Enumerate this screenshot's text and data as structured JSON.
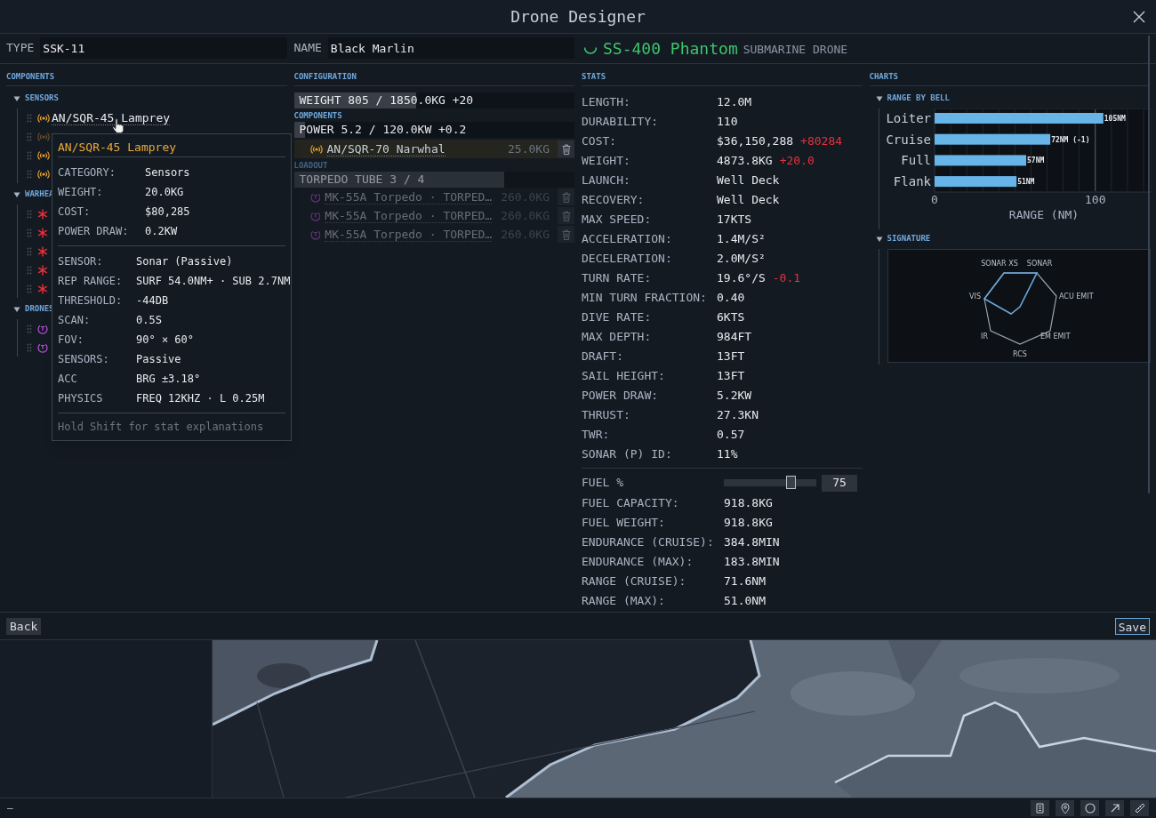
{
  "window": {
    "title": "Drone Designer"
  },
  "header": {
    "type_label": "TYPE",
    "type_value": "SSK-11",
    "name_label": "NAME",
    "name_value": "Black Marlin",
    "drone_name": "SS-400 Phantom",
    "drone_class": "SUBMARINE DRONE"
  },
  "components": {
    "title": "COMPONENTS",
    "groups": [
      {
        "label": "SENSORS",
        "expanded": true,
        "items": [
          {
            "kind": "sensor",
            "label": "AN/SQR-45 Lamprey",
            "disabled": false
          },
          {
            "kind": "sensor",
            "disabled": true
          },
          {
            "kind": "sensor",
            "disabled": false
          },
          {
            "kind": "sensor",
            "disabled": false
          }
        ]
      },
      {
        "label": "WARHEA",
        "expanded": true,
        "items": [
          {
            "kind": "warhead",
            "disabled": false
          },
          {
            "kind": "warhead",
            "disabled": false
          },
          {
            "kind": "warhead",
            "disabled": false
          },
          {
            "kind": "warhead",
            "disabled": false
          },
          {
            "kind": "warhead",
            "disabled": false
          }
        ]
      },
      {
        "label": "DRONES",
        "expanded": true,
        "items": [
          {
            "kind": "drone",
            "disabled": false
          },
          {
            "kind": "drone",
            "disabled": false
          }
        ]
      }
    ]
  },
  "tooltip": {
    "title": "AN/SQR-45 Lamprey",
    "sections": [
      [
        {
          "label": "CATEGORY:",
          "value": "Sensors"
        },
        {
          "label": "WEIGHT:",
          "value": "20.0KG"
        },
        {
          "label": "COST:",
          "value": "$80,285"
        },
        {
          "label": "POWER DRAW:",
          "value": "0.2KW"
        }
      ],
      [
        {
          "label": "SENSOR:",
          "value": "Sonar (Passive)"
        },
        {
          "label": "REP RANGE:",
          "value": "SURF 54.0NM+ · SUB 2.7NM"
        },
        {
          "label": "THRESHOLD:",
          "value": "-44DB"
        },
        {
          "label": "SCAN:",
          "value": "0.5S"
        },
        {
          "label": "FOV:",
          "value": "90° × 60°"
        },
        {
          "label": "SENSORS:",
          "value": "Passive"
        },
        {
          "label": "ACC",
          "value": "BRG ±3.18°"
        },
        {
          "label": "PHYSICS",
          "value": "FREQ 12KHZ · L 0.25M"
        }
      ]
    ],
    "hint": "Hold Shift for stat explanations"
  },
  "configuration": {
    "title": "CONFIGURATION",
    "weight_bar": {
      "text": "WEIGHT 805 / 1850.0KG +20",
      "level": 0.435
    },
    "components_label": "COMPONENTS",
    "power_bar": {
      "text": "POWER 5.2 / 120.0KW +0.2",
      "level": 0.04
    },
    "components": [
      {
        "kind": "sensor",
        "label": "AN/SQR-70 Narwhal",
        "weight": "25.0KG",
        "highlighted": true
      }
    ],
    "loadout_label": "LOADOUT",
    "tube_bar": {
      "text": "TORPEDO TUBE 3 / 4",
      "level": 0.75
    },
    "loadout": [
      {
        "kind": "drone",
        "label": "MK-55A Torpedo · TORPED…",
        "weight": "260.0KG",
        "disabled": true
      },
      {
        "kind": "drone",
        "label": "MK-55A Torpedo · TORPED…",
        "weight": "260.0KG",
        "disabled": true
      },
      {
        "kind": "drone",
        "label": "MK-55A Torpedo · TORPED…",
        "weight": "260.0KG",
        "disabled": true
      }
    ]
  },
  "stats": {
    "title": "STATS",
    "rows": [
      {
        "label": "LENGTH:",
        "value": "12.0M"
      },
      {
        "label": "DURABILITY:",
        "value": "110"
      },
      {
        "label": "COST:",
        "value": "$36,150,288",
        "delta": "+80284"
      },
      {
        "label": "WEIGHT:",
        "value": "4873.8KG",
        "delta": "+20.0"
      },
      {
        "label": "LAUNCH:",
        "value": "Well Deck"
      },
      {
        "label": "RECOVERY:",
        "value": "Well Deck"
      },
      {
        "label": "MAX SPEED:",
        "value": "17KTS"
      },
      {
        "label": "ACCELERATION:",
        "value": "1.4M/S²"
      },
      {
        "label": "DECELERATION:",
        "value": "2.0M/S²"
      },
      {
        "label": "TURN RATE:",
        "value": "19.6°/S",
        "delta": "-0.1"
      },
      {
        "label": "MIN TURN FRACTION:",
        "value": "0.40"
      },
      {
        "label": "DIVE RATE:",
        "value": "6KTS"
      },
      {
        "label": "MAX DEPTH:",
        "value": "984FT"
      },
      {
        "label": "DRAFT:",
        "value": "13FT"
      },
      {
        "label": "SAIL HEIGHT:",
        "value": "13FT"
      },
      {
        "label": "POWER DRAW:",
        "value": "5.2KW"
      },
      {
        "label": "THRUST:",
        "value": "27.3KN"
      },
      {
        "label": "TWR:",
        "value": "0.57"
      },
      {
        "label": "SONAR (P) ID:",
        "value": "11%"
      }
    ],
    "fuel": {
      "label": "FUEL %",
      "level": 0.75,
      "value": "75"
    },
    "fuel_rows": [
      {
        "label": "FUEL CAPACITY:",
        "value": "918.8KG"
      },
      {
        "label": "FUEL WEIGHT:",
        "value": "918.8KG"
      },
      {
        "label": "ENDURANCE (CRUISE):",
        "value": "384.8MIN"
      },
      {
        "label": "ENDURANCE (MAX):",
        "value": "183.8MIN"
      },
      {
        "label": "RANGE (CRUISE):",
        "value": "71.6NM"
      },
      {
        "label": "RANGE (MAX):",
        "value": "51.0NM"
      }
    ]
  },
  "charts": {
    "title": "CHARTS",
    "range_by_bell": {
      "title": "RANGE BY BELL",
      "expanded": true,
      "chart_data": {
        "type": "bar",
        "orientation": "horizontal",
        "xlabel": "RANGE (NM)",
        "categories": [
          "Loiter",
          "Cruise",
          "Full",
          "Flank"
        ],
        "values": [
          105,
          72,
          57,
          51
        ],
        "xlim": [
          0,
          135
        ],
        "xticks": [
          0,
          100
        ],
        "value_labels": [
          "105NM",
          "72NM (-1)",
          "57NM",
          "51NM"
        ]
      }
    },
    "signature": {
      "title": "SIGNATURE",
      "expanded": true,
      "axes": [
        "SONAR XS",
        "SONAR",
        "ACU EMIT",
        "EM EMIT",
        "RCS",
        "IR",
        "VIS"
      ]
    }
  },
  "footer": {
    "back": "Back",
    "save": "Save"
  },
  "status_bar": {
    "text": "—"
  }
}
